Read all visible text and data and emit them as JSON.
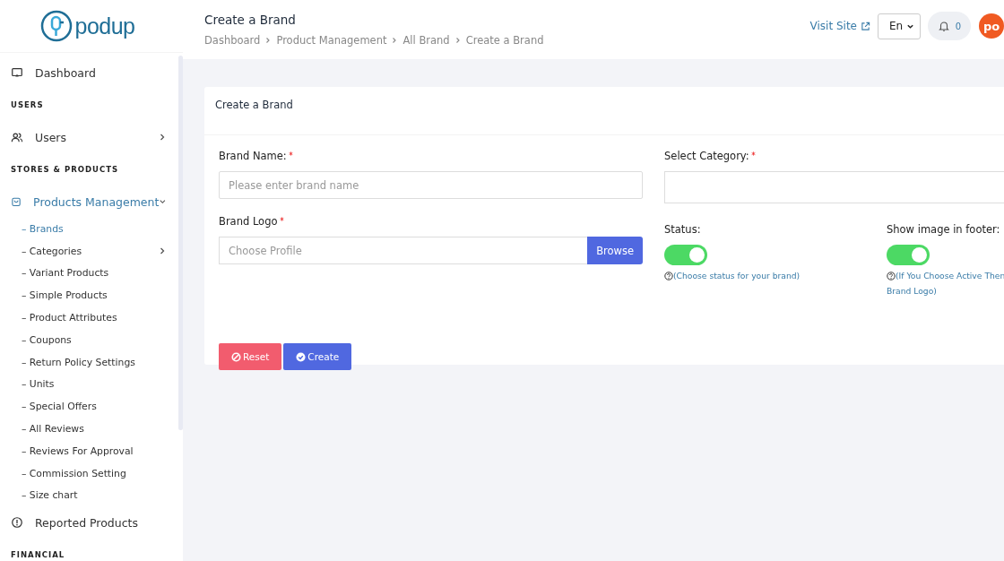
{
  "logo": {
    "text": "podup"
  },
  "sidebar": {
    "items": [
      {
        "kind": "link",
        "label": "Dashboard",
        "selected": false
      },
      {
        "kind": "section",
        "label": "USERS"
      },
      {
        "kind": "link",
        "label": "Users",
        "selected": false,
        "expanded": false
      },
      {
        "kind": "section",
        "label": "STORES & PRODUCTS"
      },
      {
        "kind": "link",
        "label": "Products Management",
        "selected": true,
        "expanded": true,
        "children": [
          {
            "label": "– Brands",
            "selected": true
          },
          {
            "label": "– Categories",
            "selected": false,
            "expanded": false
          },
          {
            "label": "– Variant Products",
            "selected": false
          },
          {
            "label": "– Simple Products",
            "selected": false
          },
          {
            "label": "– Product Attributes",
            "selected": false
          },
          {
            "label": "– Coupons",
            "selected": false
          },
          {
            "label": "– Return Policy Settings",
            "selected": false
          },
          {
            "label": "– Units",
            "selected": false
          },
          {
            "label": "– Special Offers",
            "selected": false
          },
          {
            "label": "– All Reviews",
            "selected": false
          },
          {
            "label": "– Reviews For Approval",
            "selected": false
          },
          {
            "label": "– Commission Setting",
            "selected": false
          },
          {
            "label": "– Size chart",
            "selected": false
          }
        ]
      },
      {
        "kind": "link",
        "label": "Reported Products",
        "selected": false
      },
      {
        "kind": "section",
        "label": "FINANCIAL"
      }
    ]
  },
  "header": {
    "title": "Create a Brand",
    "breadcrumb": [
      "Dashboard",
      "Product Management",
      "All Brand",
      "Create a Brand"
    ],
    "visit_site": "Visit Site",
    "language": "En",
    "notifications": "0",
    "avatar": "po"
  },
  "card": {
    "title": "Create a Brand",
    "brand_name": {
      "label": "Brand Name:",
      "required": true,
      "placeholder": "Please enter brand name"
    },
    "brand_logo": {
      "label": "Brand Logo",
      "required": true,
      "placeholder": "Choose Profile",
      "button": "Browse"
    },
    "category": {
      "label": "Select Category:",
      "required": true
    },
    "status": {
      "label": "Status:",
      "on": true,
      "hint": [
        "(Choose status for your brand)"
      ]
    },
    "footer_image": {
      "label": "Show image in footer:",
      "on": true,
      "hint": [
        "(If You Choose Active Then",
        "Brand Logo)"
      ]
    },
    "buttons": [
      {
        "kind": "reset",
        "label": "Reset"
      },
      {
        "kind": "create",
        "label": "Create"
      }
    ]
  }
}
